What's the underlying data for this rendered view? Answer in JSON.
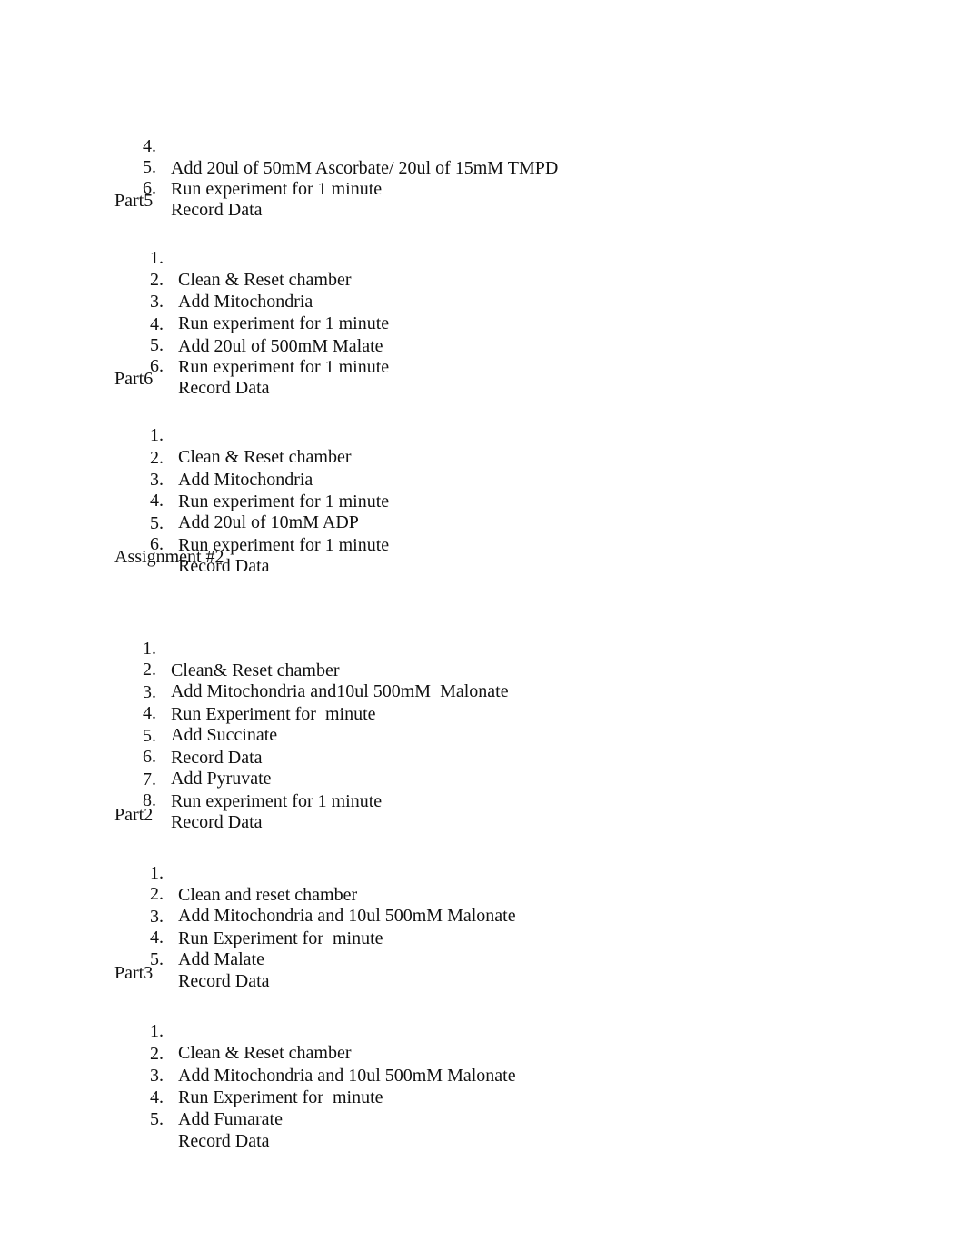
{
  "sections": [
    {
      "heading": "",
      "items": [
        {
          "n": "4.",
          "text": "Add 20ul of 50mM Ascorbate/ 20ul of 15mM TMPD"
        },
        {
          "n": "5.",
          "text": "Run experiment for 1 minute"
        },
        {
          "n": "6.",
          "text": "Record Data"
        }
      ]
    },
    {
      "heading": "Part5",
      "items": [
        {
          "n": "1.",
          "text": "Clean & Reset chamber"
        },
        {
          "n": "2.",
          "text": "Add Mitochondria"
        },
        {
          "n": "3.",
          "text": "Run experiment for 1 minute"
        },
        {
          "n": "4.",
          "text": "Add 20ul of 500mM Malate"
        },
        {
          "n": "5.",
          "text": "Run experiment for 1 minute"
        },
        {
          "n": "6.",
          "text": "Record Data"
        }
      ]
    },
    {
      "heading": "Part6",
      "items": [
        {
          "n": "1.",
          "text": "Clean & Reset chamber"
        },
        {
          "n": "2.",
          "text": "Add Mitochondria"
        },
        {
          "n": "3.",
          "text": "Run experiment for 1 minute"
        },
        {
          "n": "4.",
          "text": "Add 20ul of 10mM ADP"
        },
        {
          "n": "5.",
          "text": "Run experiment for 1 minute"
        },
        {
          "n": "6.",
          "text": "Record Data"
        }
      ]
    },
    {
      "heading": "Assignment #2",
      "items": [
        {
          "n": "1.",
          "text": "Clean& Reset chamber"
        },
        {
          "n": "2.",
          "text": "Add Mitochondria and10ul 500mM  Malonate"
        },
        {
          "n": "3.",
          "text": "Run Experiment for  minute"
        },
        {
          "n": "4.",
          "text": "Add Succinate"
        },
        {
          "n": "5.",
          "text": "Record Data"
        },
        {
          "n": "6.",
          "text": "Add Pyruvate"
        },
        {
          "n": "7.",
          "text": "Run experiment for 1 minute"
        },
        {
          "n": "8.",
          "text": "Record Data"
        }
      ]
    },
    {
      "heading": "Part2",
      "items": [
        {
          "n": "1.",
          "text": "Clean and reset chamber"
        },
        {
          "n": "2.",
          "text": "Add Mitochondria and 10ul 500mM Malonate"
        },
        {
          "n": "3.",
          "text": "Run Experiment for  minute"
        },
        {
          "n": "4.",
          "text": "Add Malate"
        },
        {
          "n": "5.",
          "text": "Record Data"
        }
      ]
    },
    {
      "heading": "Part3",
      "items": [
        {
          "n": "1.",
          "text": "Clean & Reset chamber"
        },
        {
          "n": "2.",
          "text": "Add Mitochondria and 10ul 500mM Malonate"
        },
        {
          "n": "3.",
          "text": "Run Experiment for  minute"
        },
        {
          "n": "4.",
          "text": "Add Fumarate"
        },
        {
          "n": "5.",
          "text": "Record Data"
        }
      ]
    }
  ]
}
